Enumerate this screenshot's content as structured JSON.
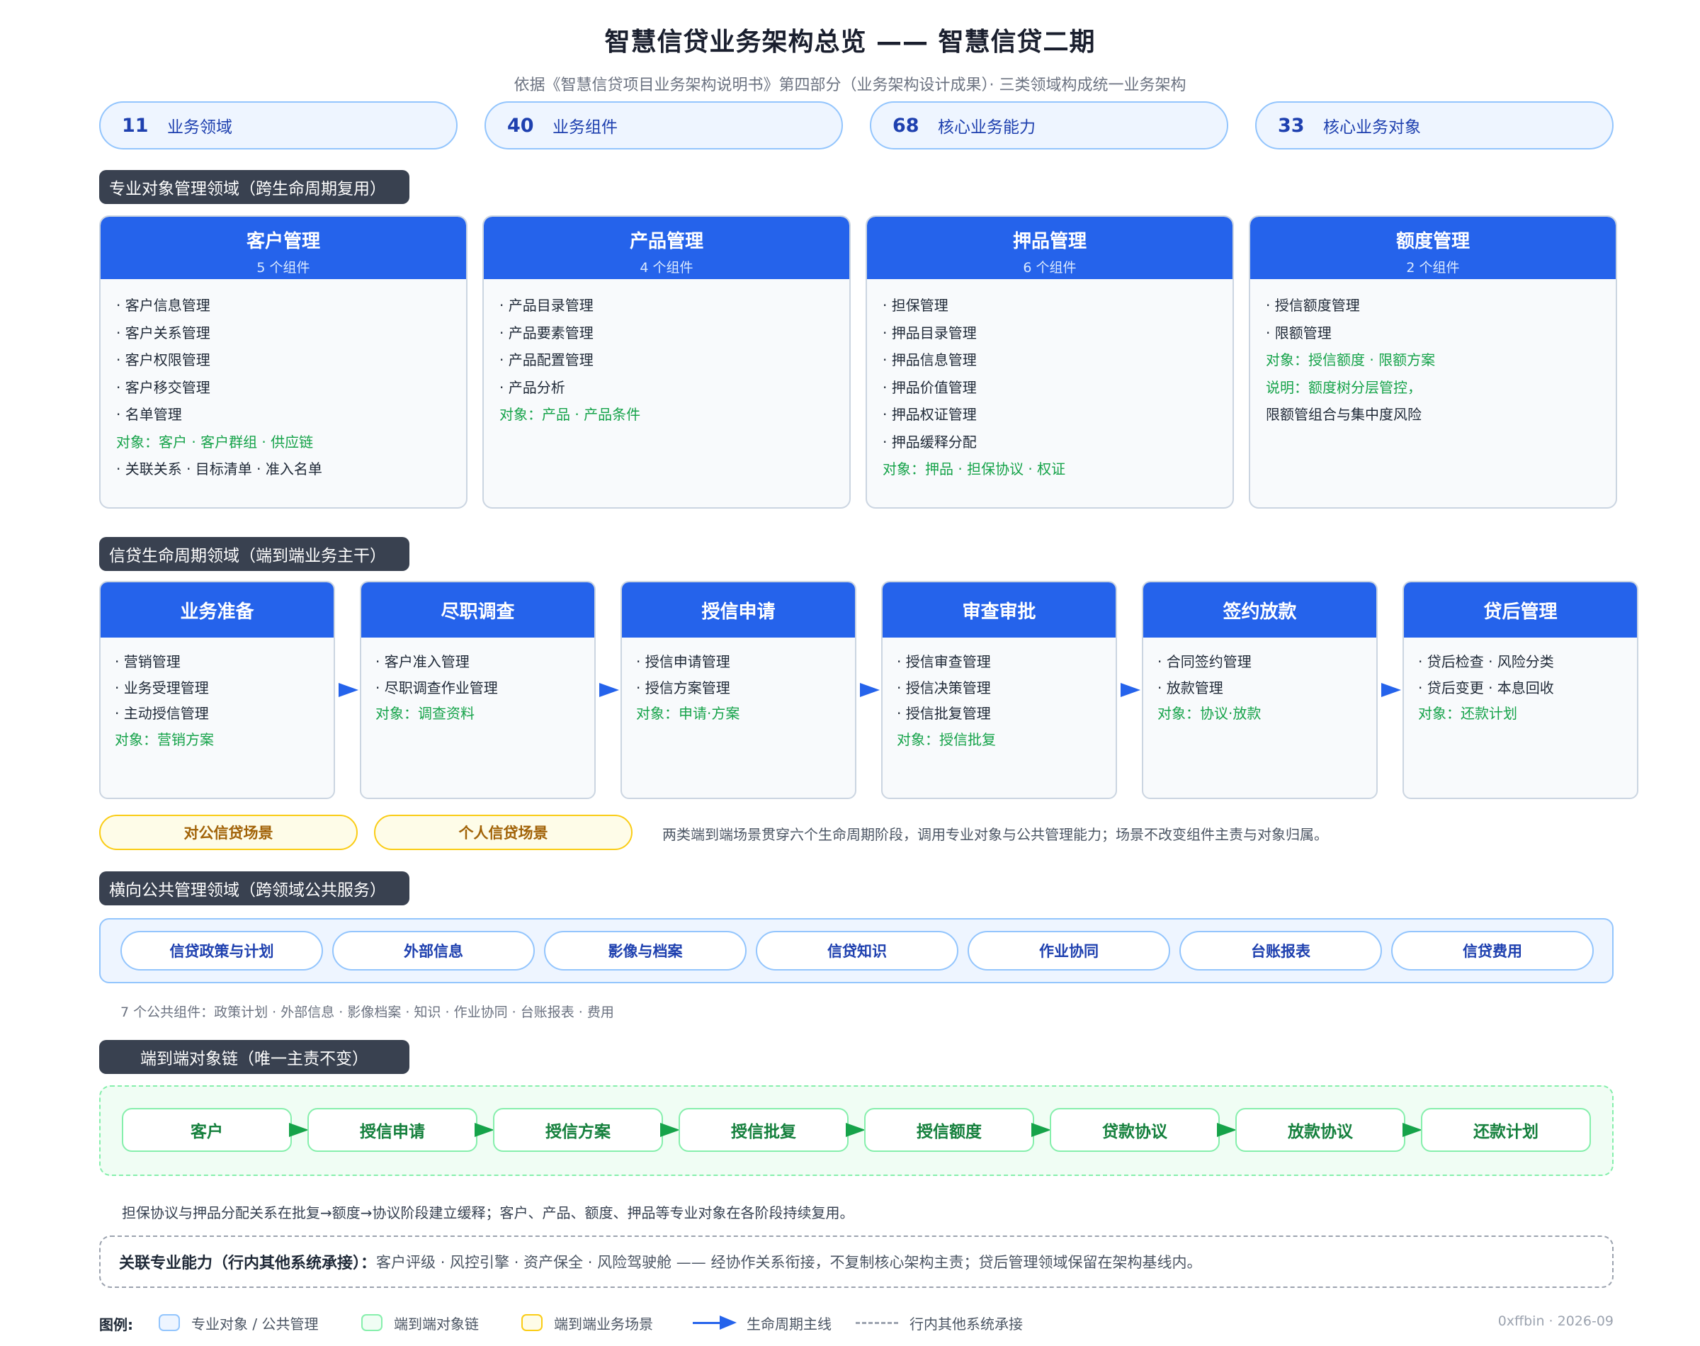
{
  "header": {
    "title": "智慧信贷业务架构总览 —— 智慧信贷二期",
    "subtitle": "依据《智慧信贷项目业务架构说明书》第四部分（业务架构设计成果）· 三类领域构成统一业务架构"
  },
  "stats": [
    {
      "num": "11",
      "label": "业务领域"
    },
    {
      "num": "40",
      "label": "业务组件"
    },
    {
      "num": "68",
      "label": "核心业务能力"
    },
    {
      "num": "33",
      "label": "核心业务对象"
    }
  ],
  "sections": {
    "professional": "专业对象管理领域（跨生命周期复用）",
    "lifecycle": "信贷生命周期领域（端到端业务主干）",
    "public": "横向公共管理领域（跨领域公共服务）",
    "chain": "端到端对象链（唯一主责不变）"
  },
  "domains": [
    {
      "name": "客户管理",
      "count": "5 个组件",
      "lines": [
        {
          "kind": "item",
          "text": "· 客户信息管理"
        },
        {
          "kind": "item",
          "text": "· 客户关系管理"
        },
        {
          "kind": "item",
          "text": "· 客户权限管理"
        },
        {
          "kind": "item",
          "text": "· 客户移交管理"
        },
        {
          "kind": "item",
          "text": "· 名单管理"
        },
        {
          "kind": "obj",
          "text": "对象：客户 · 客户群组 · 供应链"
        },
        {
          "kind": "item",
          "text": "· 关联关系 · 目标清单 · 准入名单"
        }
      ]
    },
    {
      "name": "产品管理",
      "count": "4 个组件",
      "lines": [
        {
          "kind": "item",
          "text": "· 产品目录管理"
        },
        {
          "kind": "item",
          "text": "· 产品要素管理"
        },
        {
          "kind": "item",
          "text": "· 产品配置管理"
        },
        {
          "kind": "item",
          "text": "· 产品分析"
        },
        {
          "kind": "obj",
          "text": "对象：产品 · 产品条件"
        }
      ]
    },
    {
      "name": "押品管理",
      "count": "6 个组件",
      "lines": [
        {
          "kind": "item",
          "text": "· 担保管理"
        },
        {
          "kind": "item",
          "text": "· 押品目录管理"
        },
        {
          "kind": "item",
          "text": "· 押品信息管理"
        },
        {
          "kind": "item",
          "text": "· 押品价值管理"
        },
        {
          "kind": "item",
          "text": "· 押品权证管理"
        },
        {
          "kind": "item",
          "text": "· 押品缓释分配"
        },
        {
          "kind": "obj",
          "text": "对象：押品 · 担保协议 · 权证"
        }
      ]
    },
    {
      "name": "额度管理",
      "count": "2 个组件",
      "lines": [
        {
          "kind": "item",
          "text": "· 授信额度管理"
        },
        {
          "kind": "item",
          "text": "· 限额管理"
        },
        {
          "kind": "obj",
          "text": "对象：授信额度 · 限额方案"
        },
        {
          "kind": "obj",
          "text": "说明：额度树分层管控，"
        },
        {
          "kind": "note",
          "text": "限额管组合与集中度风险"
        }
      ]
    }
  ],
  "stages": [
    {
      "name": "业务准备",
      "lines": [
        {
          "kind": "item",
          "text": "· 营销管理"
        },
        {
          "kind": "item",
          "text": "· 业务受理管理"
        },
        {
          "kind": "item",
          "text": "· 主动授信管理"
        },
        {
          "kind": "obj",
          "text": "对象：营销方案"
        }
      ]
    },
    {
      "name": "尽职调查",
      "lines": [
        {
          "kind": "item",
          "text": "· 客户准入管理"
        },
        {
          "kind": "item",
          "text": "· 尽职调查作业管理"
        },
        {
          "kind": "obj",
          "text": "对象：调查资料"
        }
      ]
    },
    {
      "name": "授信申请",
      "lines": [
        {
          "kind": "item",
          "text": "· 授信申请管理"
        },
        {
          "kind": "item",
          "text": "· 授信方案管理"
        },
        {
          "kind": "obj",
          "text": "对象：申请·方案"
        }
      ]
    },
    {
      "name": "审查审批",
      "lines": [
        {
          "kind": "item",
          "text": "· 授信审查管理"
        },
        {
          "kind": "item",
          "text": "· 授信决策管理"
        },
        {
          "kind": "item",
          "text": "· 授信批复管理"
        },
        {
          "kind": "obj",
          "text": "对象：授信批复"
        }
      ]
    },
    {
      "name": "签约放款",
      "lines": [
        {
          "kind": "item",
          "text": "· 合同签约管理"
        },
        {
          "kind": "item",
          "text": "· 放款管理"
        },
        {
          "kind": "obj",
          "text": "对象：协议·放款"
        }
      ]
    },
    {
      "name": "贷后管理",
      "lines": [
        {
          "kind": "item",
          "text": "· 贷后检查 · 风险分类"
        },
        {
          "kind": "item",
          "text": "· 贷后变更 · 本息回收"
        },
        {
          "kind": "obj",
          "text": "对象：还款计划"
        }
      ]
    }
  ],
  "scenes": {
    "corporate": "对公信贷场景",
    "personal": "个人信贷场景",
    "note": "两类端到端场景贯穿六个生命周期阶段，调用专业对象与公共管理能力；场景不改变组件主责与对象归属。"
  },
  "public_components": [
    "信贷政策与计划",
    "外部信息",
    "影像与档案",
    "信贷知识",
    "作业协同",
    "台账报表",
    "信贷费用"
  ],
  "public_note": "7 个公共组件：政策计划 · 外部信息 · 影像档案 · 知识 · 作业协同 · 台账报表 · 费用",
  "chain": [
    "客户",
    "授信申请",
    "授信方案",
    "授信批复",
    "授信额度",
    "贷款协议",
    "放款协议",
    "还款计划"
  ],
  "chain_note": "担保协议与押品分配关系在批复→额度→协议阶段建立缓释；客户、产品、额度、押品等专业对象在各阶段持续复用。",
  "associated": {
    "label": "关联专业能力（行内其他系统承接）：",
    "text": "客户评级 · 风控引擎 · 资产保全 · 风险驾驶舱 —— 经协作关系衔接，不复制核心架构主责；贷后管理领域保留在架构基线内。"
  },
  "legend": {
    "title": "图例:",
    "items": [
      "专业对象 / 公共管理",
      "端到端对象链",
      "端到端业务场景",
      "生命周期主线",
      "行内其他系统承接"
    ]
  },
  "footer": "0xffbin · 2026-09",
  "colors": {
    "primary_blue": "#2563eb",
    "object_green": "#16a34a",
    "scene_yellow": "#facc15",
    "section_dark": "#394150"
  }
}
